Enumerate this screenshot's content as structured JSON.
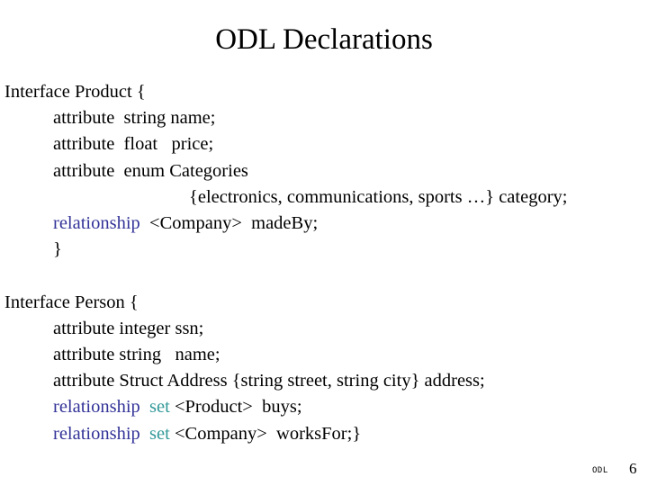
{
  "slide": {
    "title": "ODL Declarations",
    "background_color": "#ffffff",
    "text_color": "#000000",
    "keyword_relationship_color": "#333399",
    "keyword_set_color": "#339999"
  },
  "body": {
    "lines": [
      {
        "indent": 0,
        "tokens": [
          {
            "text": "Interface Product {",
            "color": "plain"
          }
        ]
      },
      {
        "indent": 1,
        "tokens": [
          {
            "text": "attribute  string name;",
            "color": "plain"
          }
        ]
      },
      {
        "indent": 1,
        "tokens": [
          {
            "text": "attribute  float   price;",
            "color": "plain"
          }
        ]
      },
      {
        "indent": 1,
        "tokens": [
          {
            "text": "attribute  enum Categories",
            "color": "plain"
          }
        ]
      },
      {
        "indent": 2,
        "tokens": [
          {
            "text": "{electronics, communications, sports …} category;",
            "color": "plain"
          }
        ]
      },
      {
        "indent": 1,
        "tokens": [
          {
            "text": "relationship",
            "color": "relationship"
          },
          {
            "text": "  <Company>  madeBy;",
            "color": "plain"
          }
        ]
      },
      {
        "indent": 1,
        "tokens": [
          {
            "text": "}",
            "color": "plain"
          }
        ]
      },
      {
        "indent": 0,
        "blank": true,
        "tokens": []
      },
      {
        "indent": 0,
        "tokens": [
          {
            "text": "Interface Person {",
            "color": "plain"
          }
        ]
      },
      {
        "indent": 1,
        "tokens": [
          {
            "text": "attribute integer ssn;",
            "color": "plain"
          }
        ]
      },
      {
        "indent": 1,
        "tokens": [
          {
            "text": "attribute string   name;",
            "color": "plain"
          }
        ]
      },
      {
        "indent": 1,
        "tokens": [
          {
            "text": "attribute Struct Address {string street, string city} address;",
            "color": "plain"
          }
        ]
      },
      {
        "indent": 1,
        "tokens": [
          {
            "text": "relationship",
            "color": "relationship"
          },
          {
            "text": "  ",
            "color": "plain"
          },
          {
            "text": "set",
            "color": "set"
          },
          {
            "text": " <Product>  buys;",
            "color": "plain"
          }
        ]
      },
      {
        "indent": 1,
        "tokens": [
          {
            "text": "relationship",
            "color": "relationship"
          },
          {
            "text": "  ",
            "color": "plain"
          },
          {
            "text": "set",
            "color": "set"
          },
          {
            "text": " <Company>  worksFor;}",
            "color": "plain"
          }
        ]
      }
    ]
  },
  "footer": {
    "tag": "ODL",
    "page_number": "6"
  }
}
